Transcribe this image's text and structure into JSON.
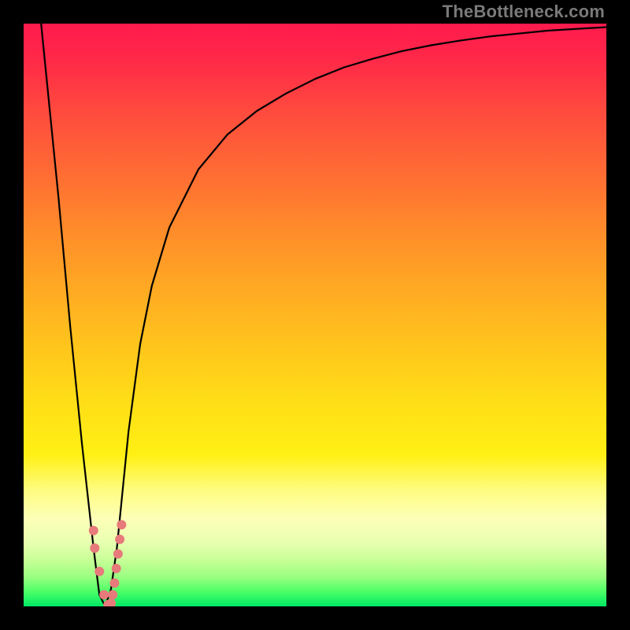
{
  "watermark": {
    "text": "TheBottleneck.com"
  },
  "chart_data": {
    "type": "line",
    "title": "",
    "xlabel": "",
    "ylabel": "",
    "xlim": [
      0,
      100
    ],
    "ylim": [
      0,
      100
    ],
    "grid": false,
    "legend": false,
    "background": {
      "type": "vertical-gradient",
      "top_color": "#ff1a4d",
      "bottom_color": "#00e864",
      "meaning": "red = bad / bottlenecked, green = good / balanced"
    },
    "series": [
      {
        "name": "bottleneck-curve",
        "color": "#000000",
        "x": [
          3,
          6,
          8,
          10,
          12,
          13,
          14,
          15,
          16,
          17,
          18,
          20,
          22,
          25,
          30,
          35,
          40,
          45,
          50,
          55,
          60,
          65,
          70,
          75,
          80,
          85,
          90,
          95,
          100
        ],
        "y": [
          100,
          70,
          48,
          28,
          10,
          2,
          0,
          3,
          10,
          20,
          30,
          45,
          55,
          65,
          75,
          81,
          85,
          88,
          90.5,
          92.5,
          94,
          95.3,
          96.3,
          97.1,
          97.8,
          98.3,
          98.8,
          99.1,
          99.4
        ]
      }
    ],
    "markers": [
      {
        "name": "cluster-points",
        "color": "#e77a7a",
        "shape": "circle",
        "x": [
          12.0,
          12.2,
          13.0,
          13.8,
          14.5,
          15.0,
          15.3,
          15.6,
          15.9,
          16.2,
          16.5,
          16.8
        ],
        "y": [
          13.0,
          10.0,
          6.0,
          2.0,
          0.3,
          0.5,
          2.0,
          4.0,
          6.5,
          9.0,
          11.5,
          14.0
        ]
      }
    ],
    "minimum": {
      "x": 14,
      "y": 0
    }
  }
}
